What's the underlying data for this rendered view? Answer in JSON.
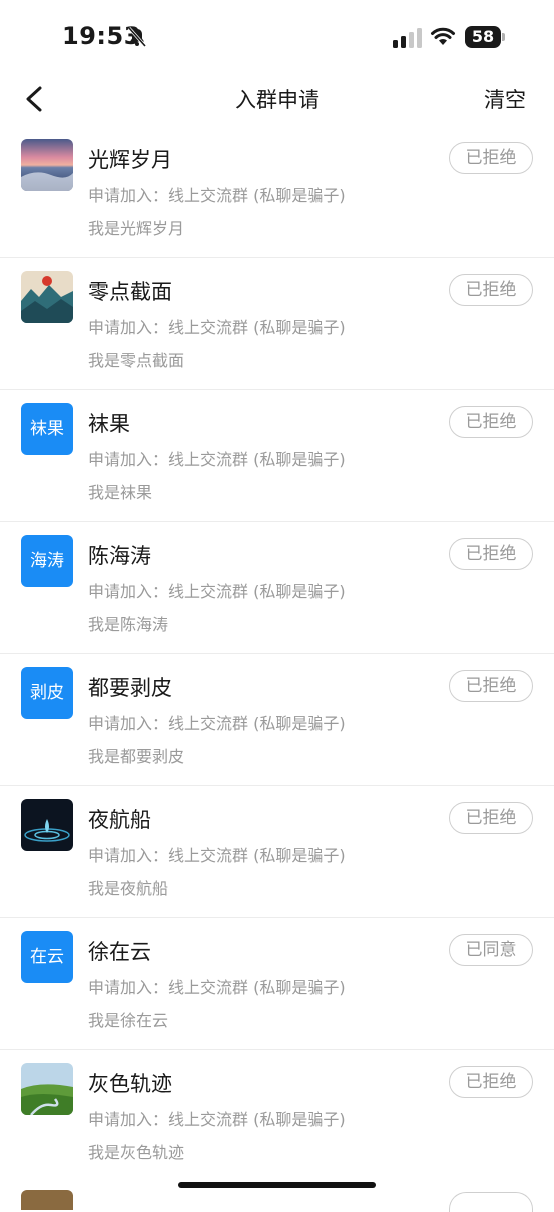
{
  "status_bar": {
    "time": "19:53",
    "battery": "58"
  },
  "nav": {
    "title": "入群申请",
    "clear_label": "清空"
  },
  "requests": [
    {
      "name": "光辉岁月",
      "apply": "申请加入：线上交流群 (私聊是骗子)",
      "message": "我是光辉岁月",
      "status": "已拒绝",
      "avatar": "sunset-sea-image"
    },
    {
      "name": "零点截面",
      "apply": "申请加入：线上交流群 (私聊是骗子)",
      "message": "我是零点截面",
      "status": "已拒绝",
      "avatar": "ink-mountain-image"
    },
    {
      "name": "袜果",
      "apply": "申请加入：线上交流群 (私聊是骗子)",
      "message": "我是袜果",
      "status": "已拒绝",
      "avatar_text": "袜果"
    },
    {
      "name": "陈海涛",
      "apply": "申请加入：线上交流群 (私聊是骗子)",
      "message": "我是陈海涛",
      "status": "已拒绝",
      "avatar_text": "海涛"
    },
    {
      "name": "都要剥皮",
      "apply": "申请加入：线上交流群 (私聊是骗子)",
      "message": "我是都要剥皮",
      "status": "已拒绝",
      "avatar_text": "剥皮"
    },
    {
      "name": "夜航船",
      "apply": "申请加入：线上交流群 (私聊是骗子)",
      "message": "我是夜航船",
      "status": "已拒绝",
      "avatar": "water-drop-image"
    },
    {
      "name": "徐在云",
      "apply": "申请加入：线上交流群 (私聊是骗子)",
      "message": "我是徐在云",
      "status": "已同意",
      "avatar_text": "在云"
    },
    {
      "name": "灰色轨迹",
      "apply": "申请加入：线上交流群 (私聊是骗子)",
      "message": "我是灰色轨迹",
      "status": "已拒绝",
      "avatar": "green-valley-image"
    }
  ],
  "colors": {
    "accent": "#1a8cf5",
    "muted_text": "#9a9a9a",
    "divider": "#ececec"
  }
}
